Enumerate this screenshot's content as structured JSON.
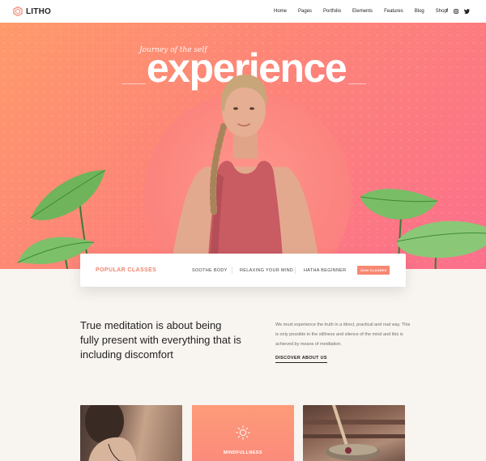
{
  "brand": {
    "name": "LITHO",
    "accent": "#f0846e"
  },
  "nav": {
    "items": [
      {
        "label": "Home"
      },
      {
        "label": "Pages"
      },
      {
        "label": "Portfolio"
      },
      {
        "label": "Elements"
      },
      {
        "label": "Features"
      },
      {
        "label": "Blog"
      },
      {
        "label": "Shop"
      }
    ],
    "social": [
      "facebook-icon",
      "instagram-icon",
      "twitter-icon"
    ]
  },
  "hero": {
    "tagline": "Journey of the self",
    "headline": "experience"
  },
  "classes": {
    "title": "POPULAR CLASSES",
    "links": [
      "SOOTHE BODY",
      "RELAXING YOUR MIND",
      "HATHA BEGINNER"
    ],
    "cta": "JOIN CLASSES"
  },
  "intro": {
    "quote": "True meditation is about being fully present with everything that is including discomfort",
    "description": "We must experience the truth in a direct, practical and real way. This is only possible in the stillness and silence of the mind and this is achieved by means of meditation.",
    "link": "DISCOVER ABOUT US"
  },
  "cards": [
    {
      "label": ""
    },
    {
      "label": "MINDFULLNESS",
      "icon": "sun-icon"
    },
    {
      "label": ""
    }
  ]
}
